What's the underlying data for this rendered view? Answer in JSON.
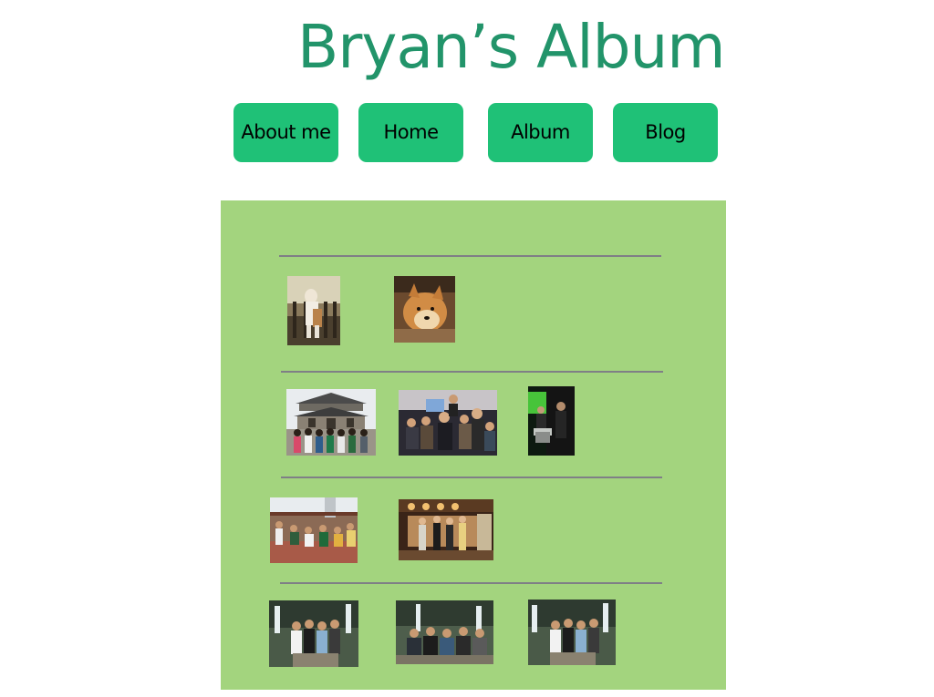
{
  "header": {
    "title": "Bryan’s Album"
  },
  "nav": {
    "items": [
      {
        "label": "About me"
      },
      {
        "label": "Home"
      },
      {
        "label": "Album"
      },
      {
        "label": "Blog"
      }
    ]
  },
  "colors": {
    "title": "#22946a",
    "nav_button": "#1fc177",
    "panel": "#a3d47e",
    "divider": "#7f7f86"
  }
}
